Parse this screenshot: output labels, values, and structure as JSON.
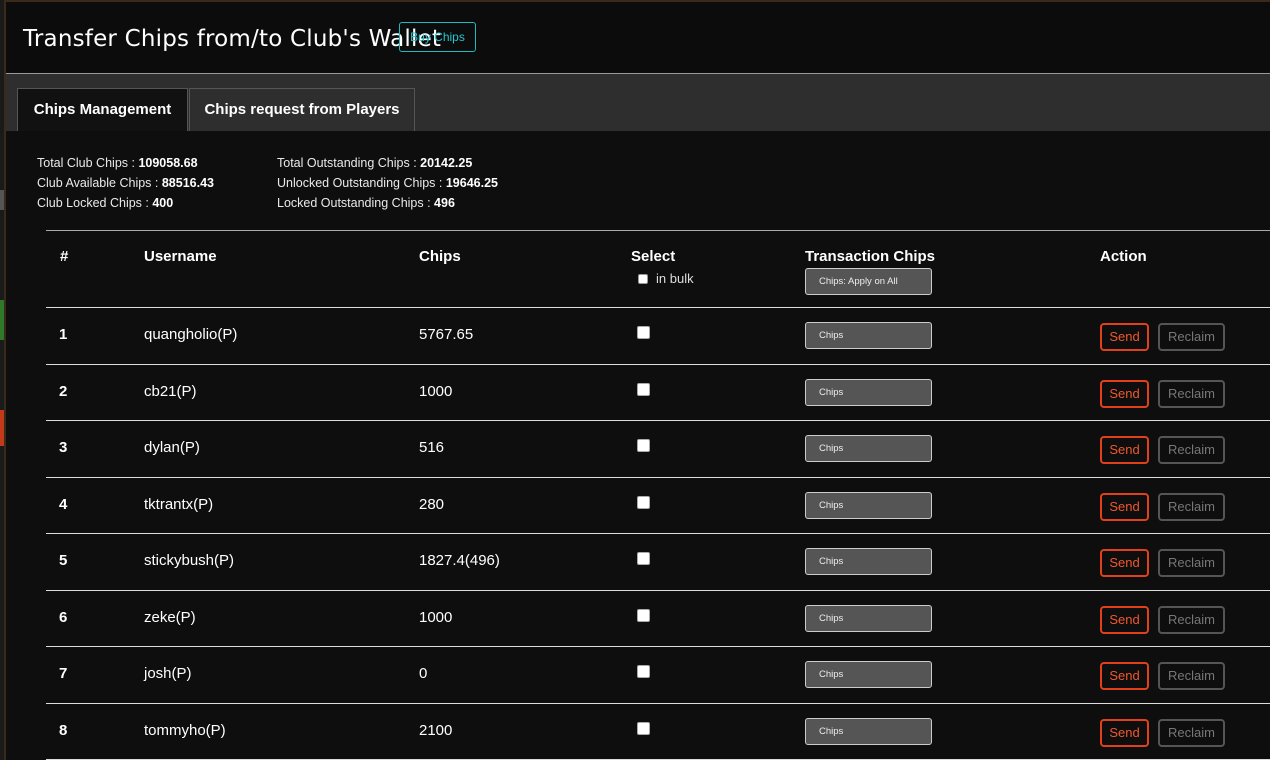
{
  "header": {
    "title": "Transfer Chips from/to Club's Wallet",
    "buy_label": "Buy Chips"
  },
  "tabs": [
    {
      "label": "Chips Management",
      "active": true
    },
    {
      "label": "Chips request from Players",
      "active": false
    }
  ],
  "stats": {
    "total_club_label": "Total Club Chips : ",
    "total_club_value": "109058.68",
    "available_label": "Club Available Chips : ",
    "available_value": "88516.43",
    "locked_label": "Club Locked Chips : ",
    "locked_value": "400",
    "total_outstanding_label": "Total Outstanding Chips : ",
    "total_outstanding_value": "20142.25",
    "unlocked_outstanding_label": "Unlocked Outstanding Chips : ",
    "unlocked_outstanding_value": "19646.25",
    "locked_outstanding_label": "Locked Outstanding Chips : ",
    "locked_outstanding_value": "496"
  },
  "table": {
    "headers": {
      "num": "#",
      "username": "Username",
      "chips": "Chips",
      "select": "Select",
      "bulk": "in bulk",
      "transaction": "Transaction Chips",
      "action": "Action"
    },
    "apply_all_placeholder": "Chips: Apply on All",
    "chips_placeholder": "Chips",
    "send_label": "Send",
    "reclaim_label": "Reclaim",
    "rows": [
      {
        "num": "1",
        "username": "quangholio(P)",
        "chips": "5767.65"
      },
      {
        "num": "2",
        "username": "cb21(P)",
        "chips": "1000"
      },
      {
        "num": "3",
        "username": "dylan(P)",
        "chips": "516"
      },
      {
        "num": "4",
        "username": "tktrantx(P)",
        "chips": "280"
      },
      {
        "num": "5",
        "username": "stickybush(P)",
        "chips": "1827.4(496)"
      },
      {
        "num": "6",
        "username": "zeke(P)",
        "chips": "1000"
      },
      {
        "num": "7",
        "username": "josh(P)",
        "chips": "0"
      },
      {
        "num": "8",
        "username": "tommyho(P)",
        "chips": "2100"
      }
    ]
  },
  "colors": {
    "accent_cyan": "#22c7cf",
    "send_orange": "#e0401a",
    "background": "#0e0e0e"
  }
}
